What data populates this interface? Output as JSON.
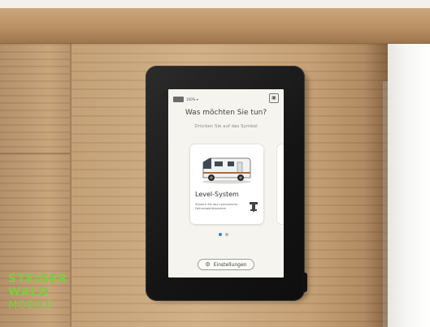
{
  "status_bar": {
    "battery_text": "100% ▾"
  },
  "header": {
    "title": "Was möchten Sie tun?",
    "subtitle": "Drücken Sie auf das Symbol"
  },
  "card": {
    "title": "Level-System",
    "description": "Steuern Sie das hydraulische Fahrzeugstützsystem"
  },
  "pagination": {
    "current": 1,
    "total": 2
  },
  "settings_button": {
    "label": "Einstellungen"
  },
  "watermark": {
    "line1": "STEIGER",
    "line2": "WALD",
    "line3": "MOBILE"
  },
  "colors": {
    "logo_green": "#7ecb3f",
    "active_dot": "#3a7fd6"
  }
}
